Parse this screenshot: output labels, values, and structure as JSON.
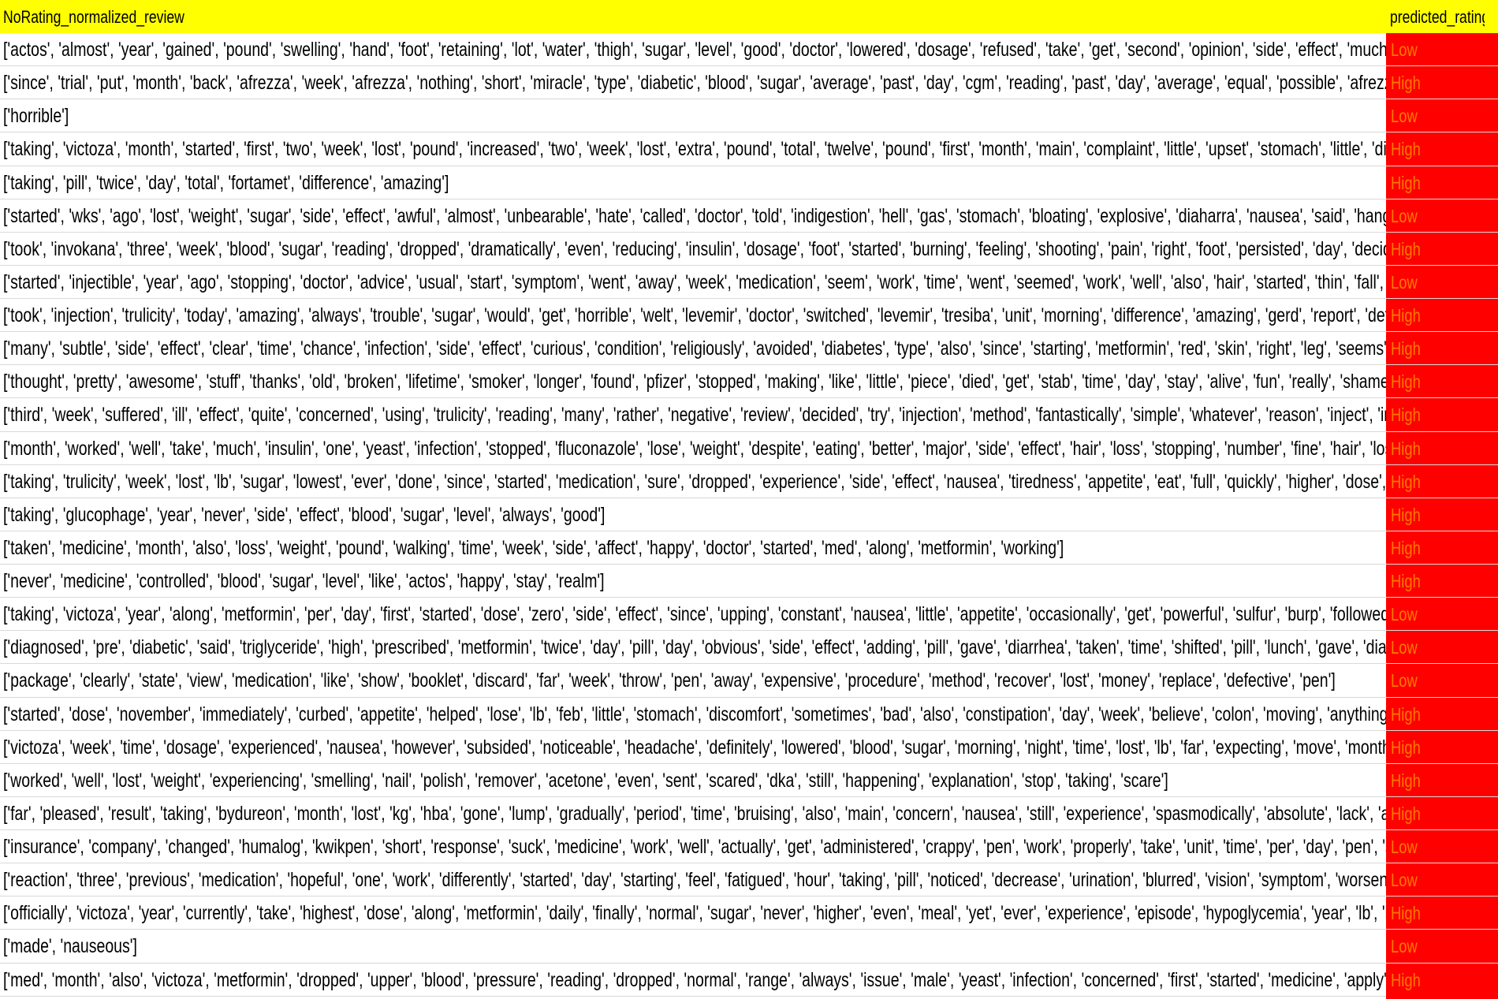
{
  "colors": {
    "header_bg": "#ffff00",
    "rating_bg": "#ff0000",
    "rating_text": "#ff7a00",
    "grid_line": "#d9d9d9"
  },
  "header": {
    "review_col": "NoRating_normalized_review",
    "rating_col": "predicted_ratings"
  },
  "rows": [
    {
      "review": "['actos', 'almost', 'year', 'gained', 'pound', 'swelling', 'hand', 'foot', 'retaining', 'lot', 'water', 'thigh', 'sugar', 'level', 'good', 'doctor', 'lowered', 'dosage', 'refused', 'take', 'get', 'second', 'opinion', 'side', 'effect', 'much']",
      "rating": "Low"
    },
    {
      "review": "['since', 'trial', 'put', 'month', 'back', 'afrezza', 'week', 'afrezza', 'nothing', 'short', 'miracle', 'type', 'diabetic', 'blood', 'sugar', 'average', 'past', 'day', 'cgm', 'reading', 'past', 'day', 'average', 'equal', 'possible', 'afrezza', 'mimic', 'speed', 'healthy', '",
      "rating": "High"
    },
    {
      "review": "['horrible']",
      "rating": "Low"
    },
    {
      "review": "['taking', 'victoza', 'month', 'started', 'first', 'two', 'week', 'lost', 'pound', 'increased', 'two', 'week', 'lost', 'extra', 'pound', 'total', 'twelve', 'pound', 'first', 'month', 'main', 'complaint', 'little', 'upset', 'stomach', 'little', 'diarrhea', 'handle', 'sake', '",
      "rating": "High"
    },
    {
      "review": "['taking', 'pill', 'twice', 'day', 'total', 'fortamet', 'difference', 'amazing']",
      "rating": "High"
    },
    {
      "review": "['started', 'wks', 'ago', 'lost', 'weight', 'sugar', 'side', 'effect', 'awful', 'almost', 'unbearable', 'hate', 'called', 'doctor', 'told', 'indigestion', 'hell', 'gas', 'stomach', 'bloating', 'explosive', 'diaharra', 'nausea', 'said', 'hang', 'get', 'better', 'took', 'last', '",
      "rating": "Low"
    },
    {
      "review": "['took', 'invokana', 'three', 'week', 'blood', 'sugar', 'reading', 'dropped', 'dramatically', 'even', 'reducing', 'insulin', 'dosage', 'foot', 'started', 'burning', 'feeling', 'shooting', 'pain', 'right', 'foot', 'persisted', 'day', 'decided', 'want', 'think', 'potentia",
      "rating": "High"
    },
    {
      "review": "['started', 'injectible', 'year', 'ago', 'stopping', 'doctor', 'advice', 'usual', 'start', 'symptom', 'went', 'away', 'week', 'medication', 'seem', 'work', 'time', 'went', 'seemed', 'work', 'well', 'also', 'hair', 'started', 'thin', 'fall', 'mildly', 'tinnitus', 'definite",
      "rating": "Low"
    },
    {
      "review": "['took', 'injection', 'trulicity', 'today', 'amazing', 'always', 'trouble', 'sugar', 'would', 'get', 'horrible', 'welt', 'levemir', 'doctor', 'switched', 'levemir', 'tresiba', 'unit', 'morning', 'difference', 'amazing', 'gerd', 'report', 'definitely', 'worse', 'sugar', 'us",
      "rating": "High"
    },
    {
      "review": "['many', 'subtle', 'side', 'effect', 'clear', 'time', 'chance', 'infection', 'side', 'effect', 'curious', 'condition', 'religiously', 'avoided', 'diabetes', 'type', 'also', 'since', 'starting', 'metformin', 'red', 'skin', 'right', 'leg', 'seems', 'never', 'away', 'coincidenc",
      "rating": "High"
    },
    {
      "review": "['thought', 'pretty', 'awesome', 'stuff', 'thanks', 'old', 'broken', 'lifetime', 'smoker', 'longer', 'found', 'pfizer', 'stopped', 'making', 'like', 'little', 'piece', 'died', 'get', 'stab', 'time', 'day', 'stay', 'alive', 'fun', 'really', 'shame', 'american', 'lung', 'cancer",
      "rating": "High"
    },
    {
      "review": "['third', 'week', 'suffered', 'ill', 'effect', 'quite', 'concerned', 'using', 'trulicity', 'reading', 'many', 'rather', 'negative', 'review', 'decided', 'try', 'injection', 'method', 'fantastically', 'simple', 'whatever', 'reason', 'inject', 'insulin', 'wife', 'daily', 'some",
      "rating": "High"
    },
    {
      "review": "['month', 'worked', 'well', 'take', 'much', 'insulin', 'one', 'yeast', 'infection', 'stopped', 'fluconazole', 'lose', 'weight', 'despite', 'eating', 'better', 'major', 'side', 'effect', 'hair', 'loss', 'stopping', 'number', 'fine', 'hair', 'loss', 'crappy', 'texture', 'wor",
      "rating": "High"
    },
    {
      "review": "['taking', 'trulicity', 'week', 'lost', 'lb', 'sugar', 'lowest', 'ever', 'done', 'since', 'started', 'medication', 'sure', 'dropped', 'experience', 'side', 'effect', 'nausea', 'tiredness', 'appetite', 'eat', 'full', 'quickly', 'higher', 'dose', 'reduced', 'amount', 'lantus', '",
      "rating": "High"
    },
    {
      "review": "['taking', 'glucophage', 'year', 'never', 'side', 'effect', 'blood', 'sugar', 'level', 'always', 'good']",
      "rating": "High"
    },
    {
      "review": "['taken', 'medicine', 'month', 'also', 'loss', 'weight', 'pound', 'walking', 'time', 'week', 'side', 'affect', 'happy', 'doctor', 'started', 'med', 'along', 'metformin', 'working']",
      "rating": "High"
    },
    {
      "review": "['never', 'medicine', 'controlled', 'blood', 'sugar', 'level', 'like', 'actos', 'happy', 'stay', 'realm']",
      "rating": "High"
    },
    {
      "review": "['taking', 'victoza', 'year', 'along', 'metformin', 'per', 'day', 'first', 'started', 'dose', 'zero', 'side', 'effect', 'since', 'upping', 'constant', 'nausea', 'little', 'appetite', 'occasionally', 'get', 'powerful', 'sulfur', 'burp', 'followed', 'vomiting', 'medicine', 'ke",
      "rating": "Low"
    },
    {
      "review": "['diagnosed', 'pre', 'diabetic', 'said', 'triglyceride', 'high', 'prescribed', 'metformin', 'twice', 'day', 'pill', 'day', 'obvious', 'side', 'effect', 'adding', 'pill', 'gave', 'diarrhea', 'taken', 'time', 'shifted', 'pill', 'lunch', 'gave', 'diarrhea', 'day', 'row', 'worked', '",
      "rating": "Low"
    },
    {
      "review": "['package', 'clearly', 'state', 'view', 'medication', 'like', 'show', 'booklet', 'discard', 'far', 'week', 'throw', 'pen', 'away', 'expensive', 'procedure', 'method', 'recover', 'lost', 'money', 'replace', 'defective', 'pen']",
      "rating": "Low"
    },
    {
      "review": "['started', 'dose', 'november', 'immediately', 'curbed', 'appetite', 'helped', 'lose', 'lb', 'feb', 'little', 'stomach', 'discomfort', 'sometimes', 'bad', 'also', 'constipation', 'day', 'week', 'believe', 'colon', 'moving', 'anything', 'med', 'slows', 'digestion', '",
      "rating": "High"
    },
    {
      "review": "['victoza', 'week', 'time', 'dosage', 'experienced', 'nausea', 'however', 'subsided', 'noticeable', 'headache', 'definitely', 'lowered', 'blood', 'sugar', 'morning', 'night', 'time', 'lost', 'lb', 'far', 'expecting', 'move', 'month', 'miss', 'food', 'definitely', 'r",
      "rating": "High"
    },
    {
      "review": "['worked', 'well', 'lost', 'weight', 'experiencing', 'smelling', 'nail', 'polish', 'remover', 'acetone', 'even', 'sent', 'scared', 'dka', 'still', 'happening', 'explanation', 'stop', 'taking', 'scare']",
      "rating": "High"
    },
    {
      "review": "['far', 'pleased', 'result', 'taking', 'bydureon', 'month', 'lost', 'kg', 'hba', 'gone', 'lump', 'gradually', 'period', 'time', 'bruising', 'also', 'main', 'concern', 'nausea', 'still', 'experience', 'spasmodically', 'absolute', 'lack', 'appetite', 'certain', 'food', 'lool",
      "rating": "High"
    },
    {
      "review": "['insurance', 'company', 'changed', 'humalog', 'kwikpen', 'short', 'response', 'suck', 'medicine', 'work', 'well', 'actually', 'get', 'administered', 'crappy', 'pen', 'work', 'properly', 'take', 'unit', 'time', 'per', 'day', 'pen', 'seem', 'develop', 'enough', 'pr",
      "rating": "Low"
    },
    {
      "review": "['reaction', 'three', 'previous', 'medication', 'hopeful', 'one', 'work', 'differently', 'started', 'day', 'starting', 'feel', 'fatigued', 'hour', 'taking', 'pill', 'noticed', 'decrease', 'urination', 'blurred', 'vision', 'symptom', 'worsened', 'next', 'couple', 'day', '",
      "rating": "Low"
    },
    {
      "review": "['officially', 'victoza', 'year', 'currently', 'take', 'highest', 'dose', 'along', 'metformin', 'daily', 'finally', 'normal', 'sugar', 'never', 'higher', 'even', 'meal', 'yet', 'ever', 'experience', 'episode', 'hypoglycemia', 'year', 'lb', 'le', 'desire', 'active', 'healthy', '",
      "rating": "High"
    },
    {
      "review": "['made', 'nauseous']",
      "rating": "Low"
    },
    {
      "review": "['med', 'month', 'also', 'victoza', 'metformin', 'dropped', 'upper', 'blood', 'pressure', 'reading', 'dropped', 'normal', 'range', 'always', 'issue', 'male', 'yeast', 'infection', 'concerned', 'first', 'started', 'medicine', 'apply', 'steriod', 'antifungal', 'crean",
      "rating": "High"
    }
  ]
}
